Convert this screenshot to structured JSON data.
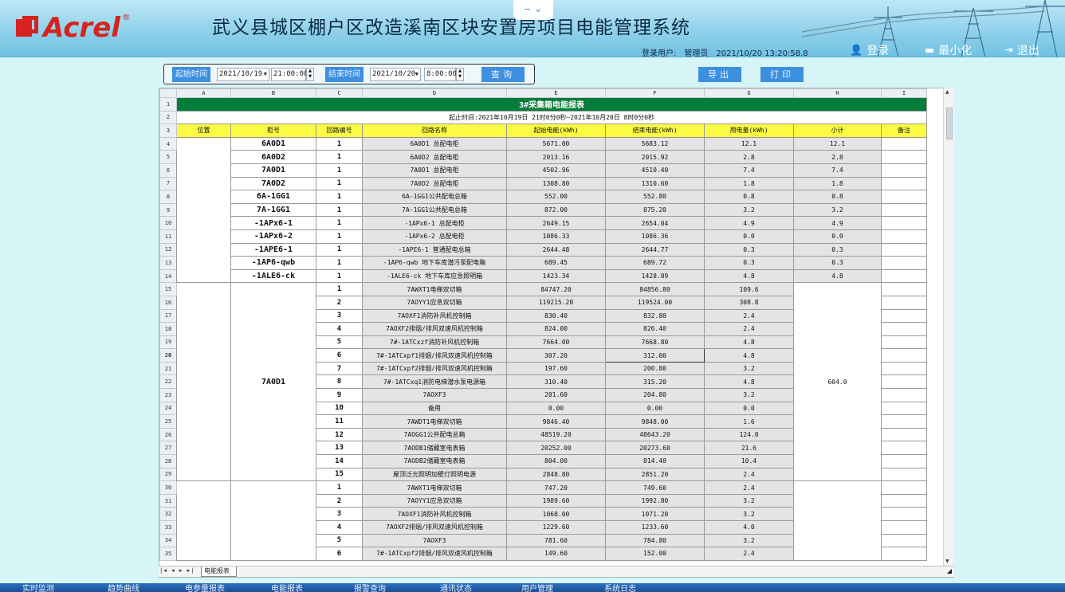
{
  "header": {
    "logo_text": "Acrel",
    "logo_reg": "®",
    "title": "武义县城区棚户区改造溪南区块安置房项目电能管理系统",
    "collapse_icon": "chevron-down-icon",
    "login_user_label": "登录用户:",
    "login_user": "管理员",
    "datetime": "2021/10/20  13:20:58.8",
    "login_btn": "登录",
    "minimize_btn": "最小化",
    "exit_btn": "退出"
  },
  "toolbar": {
    "start_label": "起始时间",
    "start_date": "2021/10/19",
    "start_time": "21:00:00",
    "end_label": "结束时间",
    "end_date": "2021/10/20",
    "end_time": "8:00:00",
    "query_btn": "查询",
    "export_btn": "导出",
    "print_btn": "打印"
  },
  "sheet": {
    "columns": [
      "",
      "A",
      "B",
      "C",
      "D",
      "E",
      "F",
      "G",
      "H",
      "I"
    ],
    "title": "3#采集箱电能报表",
    "time_range": "起止时间:2021年10月19日 21时0分0秒—2021年10月20日 8时0分0秒",
    "headers": [
      "位置",
      "柜号",
      "回路编号",
      "回路名称",
      "起始电能(kWh)",
      "结束电能(kWh)",
      "用电量(kWh)",
      "小计",
      "备注"
    ],
    "single_rows": [
      {
        "row": "4",
        "cab": "6A0D1",
        "no": "1",
        "name": "6A0D1          总配电柜",
        "start": "5671.00",
        "end": "5683.12",
        "usage": "12.1",
        "sub": "12.1"
      },
      {
        "row": "5",
        "cab": "6A0D2",
        "no": "1",
        "name": "6A0D2            总配电柜",
        "start": "2013.16",
        "end": "2015.92",
        "usage": "2.8",
        "sub": "2.8"
      },
      {
        "row": "6",
        "cab": "7A0D1",
        "no": "1",
        "name": "7A0D1          总配电柜",
        "start": "4502.96",
        "end": "4510.40",
        "usage": "7.4",
        "sub": "7.4"
      },
      {
        "row": "7",
        "cab": "7A0D2",
        "no": "1",
        "name": "7A0D2          总配电柜",
        "start": "1308.80",
        "end": "1310.60",
        "usage": "1.8",
        "sub": "1.8"
      },
      {
        "row": "8",
        "cab": "6A-1GG1",
        "no": "1",
        "name": "6A-1GG1公共配电总箱",
        "start": "552.00",
        "end": "552.80",
        "usage": "0.8",
        "sub": "0.8"
      },
      {
        "row": "9",
        "cab": "7A-1GG1",
        "no": "1",
        "name": "7A-1GG1公共配电总箱",
        "start": "872.00",
        "end": "875.20",
        "usage": "3.2",
        "sub": "3.2"
      },
      {
        "row": "10",
        "cab": "-1APx6-1",
        "no": "1",
        "name": "-1APx6-1       总配电柜",
        "start": "2649.15",
        "end": "2654.04",
        "usage": "4.9",
        "sub": "4.9"
      },
      {
        "row": "11",
        "cab": "-1APx6-2",
        "no": "1",
        "name": "-1APx6-2       总配电柜",
        "start": "1086.33",
        "end": "1086.36",
        "usage": "0.0",
        "sub": "0.0"
      },
      {
        "row": "12",
        "cab": "-1APE6-1",
        "no": "1",
        "name": "-1APE6-1     普通配电总箱",
        "start": "2644.48",
        "end": "2644.77",
        "usage": "0.3",
        "sub": "0.3"
      },
      {
        "row": "13",
        "cab": "-1AP6-qwb",
        "no": "1",
        "name": "-1AP6-qwb  地下车库潜污泵配电箱",
        "start": "689.45",
        "end": "689.72",
        "usage": "0.3",
        "sub": "0.3"
      },
      {
        "row": "14",
        "cab": "-1ALE6-ck",
        "no": "1",
        "name": "-1ALE6-ck 地下车库应急照明箱",
        "start": "1423.34",
        "end": "1428.09",
        "usage": "4.8",
        "sub": "4.8"
      }
    ],
    "group1": {
      "cab": "7A0D1",
      "subtotal": "604.0",
      "rows": [
        {
          "row": "15",
          "no": "1",
          "name": "7AWXT1电梯双切箱",
          "start": "84747.20",
          "end": "84856.80",
          "usage": "109.6"
        },
        {
          "row": "16",
          "no": "2",
          "name": "7AOYY1应急双切箱",
          "start": "119215.20",
          "end": "119524.00",
          "usage": "308.8"
        },
        {
          "row": "17",
          "no": "3",
          "name": "7AOXF1消防补风机控制箱",
          "start": "830.40",
          "end": "832.80",
          "usage": "2.4"
        },
        {
          "row": "18",
          "no": "4",
          "name": "7AOXF2排烟/排风双速风机控制箱",
          "start": "824.00",
          "end": "826.40",
          "usage": "2.4"
        },
        {
          "row": "19",
          "no": "5",
          "name": "7#-1ATCxzf消防补风机控制箱",
          "start": "7664.00",
          "end": "7668.80",
          "usage": "4.8"
        },
        {
          "row": "20",
          "no": "6",
          "name": "7#-1ATCxpf1排烟/排风双速风机控制箱",
          "start": "307.20",
          "end": "312.00",
          "usage": "4.8"
        },
        {
          "row": "21",
          "no": "7",
          "name": "7#-1ATCxpf2排烟/排风双速风机控制箱",
          "start": "197.60",
          "end": "200.80",
          "usage": "3.2"
        },
        {
          "row": "22",
          "no": "8",
          "name": "7#-1ATCxq1消防电梯潜水泵电源箱",
          "start": "310.40",
          "end": "315.20",
          "usage": "4.8"
        },
        {
          "row": "23",
          "no": "9",
          "name": "7AOXF3",
          "start": "201.60",
          "end": "204.80",
          "usage": "3.2"
        },
        {
          "row": "24",
          "no": "10",
          "name": "备用",
          "start": "0.00",
          "end": "0.00",
          "usage": "0.0"
        },
        {
          "row": "25",
          "no": "11",
          "name": "7AWDT1电梯双切箱",
          "start": "9846.40",
          "end": "9848.00",
          "usage": "1.6"
        },
        {
          "row": "26",
          "no": "12",
          "name": "7AOGG1公共配电总箱",
          "start": "48519.20",
          "end": "48643.20",
          "usage": "124.0"
        },
        {
          "row": "27",
          "no": "13",
          "name": "7AODB1储藏室电表箱",
          "start": "20252.00",
          "end": "20273.60",
          "usage": "21.6"
        },
        {
          "row": "28",
          "no": "14",
          "name": "7AODB2储藏室电表箱",
          "start": "804.00",
          "end": "814.40",
          "usage": "10.4"
        },
        {
          "row": "29",
          "no": "15",
          "name": "屋顶泛光照明加壁灯照明电源",
          "start": "2848.80",
          "end": "2851.20",
          "usage": "2.4"
        }
      ]
    },
    "group2": {
      "rows": [
        {
          "row": "30",
          "no": "1",
          "name": "7AWXT1电梯双切箱",
          "start": "747.20",
          "end": "749.60",
          "usage": "2.4"
        },
        {
          "row": "31",
          "no": "2",
          "name": "7AOYY1应急双切箱",
          "start": "1989.60",
          "end": "1992.80",
          "usage": "3.2"
        },
        {
          "row": "32",
          "no": "3",
          "name": "7AOXF1消防补风机控制箱",
          "start": "1068.00",
          "end": "1071.20",
          "usage": "3.2"
        },
        {
          "row": "33",
          "no": "4",
          "name": "7AOXF2排烟/排风双速风机控制箱",
          "start": "1229.60",
          "end": "1233.60",
          "usage": "4.0"
        },
        {
          "row": "34",
          "no": "5",
          "name": "7AOXF3",
          "start": "781.60",
          "end": "784.80",
          "usage": "3.2"
        },
        {
          "row": "35",
          "no": "6",
          "name": "7#-1ATCxpf2排烟/排风双速风机控制箱",
          "start": "149.60",
          "end": "152.00",
          "usage": "2.4"
        }
      ]
    },
    "sheet_tab": "电能报表",
    "sheet_nav": "|◂ ◂ ▸ ▸|"
  },
  "bottom_nav": [
    "实时监测",
    "趋势曲线",
    "电参量报表",
    "电能报表",
    "报警查询",
    "通讯状态",
    "用户管理",
    "系统日志"
  ]
}
